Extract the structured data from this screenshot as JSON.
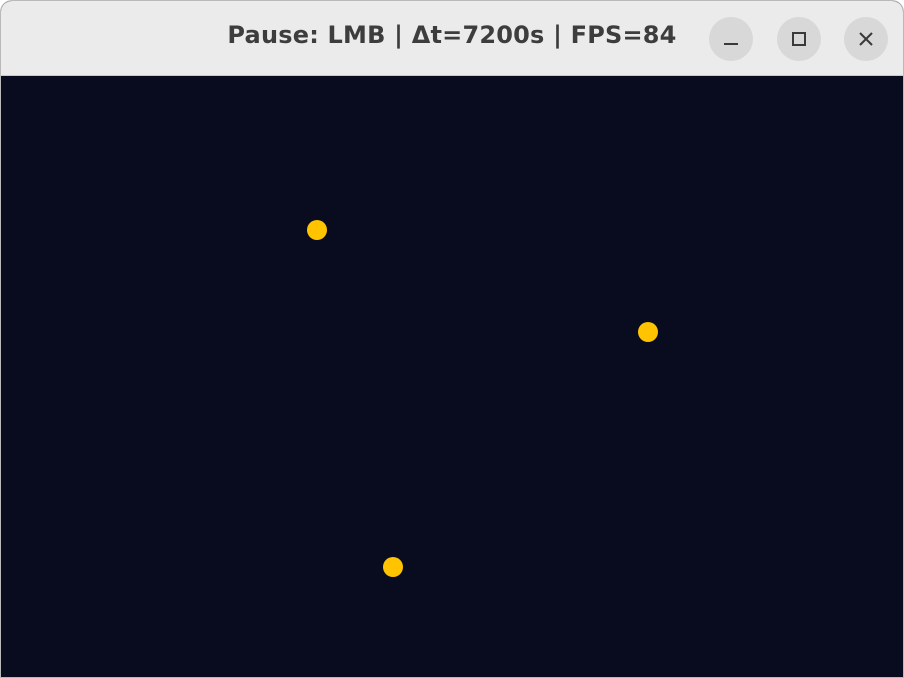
{
  "window": {
    "title": "Pause: LMB | Δt=7200s | FPS=84",
    "controls": {
      "minimize_icon": "minimize-icon",
      "maximize_icon": "maximize-icon",
      "close_icon": "close-icon"
    }
  },
  "simulation": {
    "background_color": "#090c1f",
    "body_color": "#ffc300",
    "body_count": 3
  }
}
